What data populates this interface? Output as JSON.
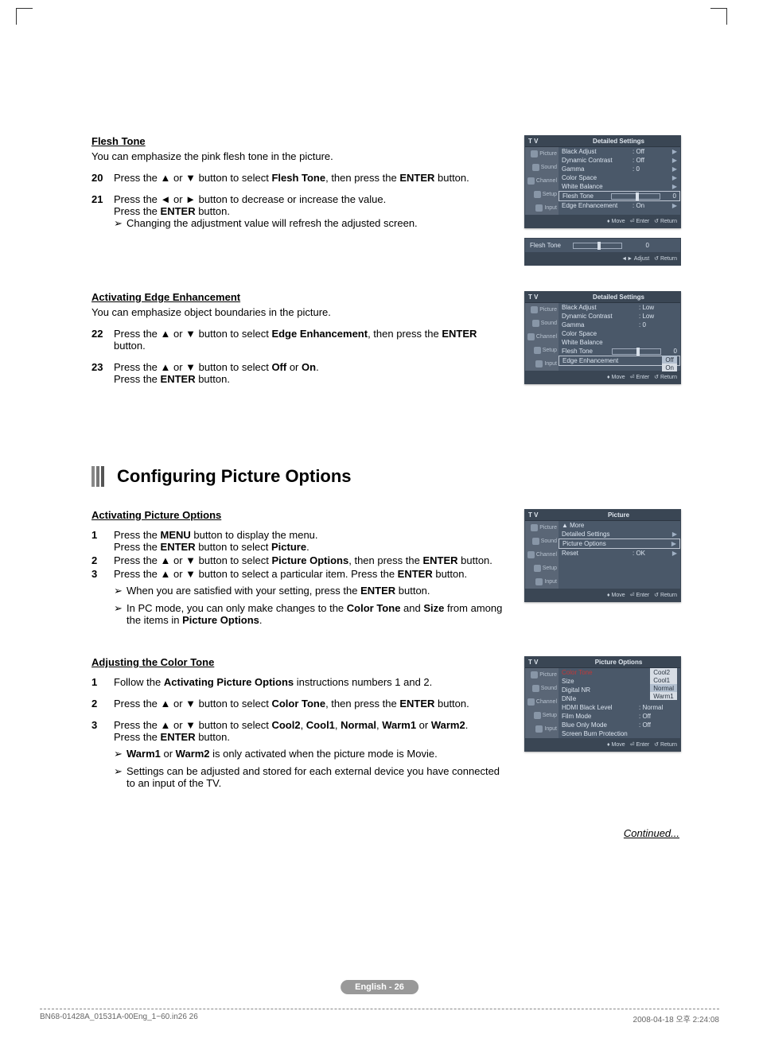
{
  "sections": {
    "flesh_tone": {
      "title": "Flesh Tone",
      "intro": "You can emphasize the pink flesh tone in the picture.",
      "step20_num": "20",
      "step20": "Press the ▲ or ▼ button to select <b>Flesh Tone</b>, then press the <b>ENTER</b> button.",
      "step21_num": "21",
      "step21a": "Press the ◄ or ► button to decrease or increase the value.",
      "step21b": "Press the <b>ENTER</b> button.",
      "step21_note": "Changing the adjustment value will refresh the adjusted screen."
    },
    "edge": {
      "title": "Activating Edge Enhancement",
      "intro": "You can emphasize object boundaries in the picture.",
      "step22_num": "22",
      "step22": "Press the ▲ or ▼ button to select <b>Edge Enhancement</b>, then press the <b>ENTER</b> button.",
      "step23_num": "23",
      "step23a": "Press the ▲ or ▼ button to select <b>Off</b> or <b>On</b>.",
      "step23b": "Press the <b>ENTER</b> button."
    },
    "conf_heading": "Configuring Picture Options",
    "activating": {
      "title": "Activating Picture Options",
      "s1_num": "1",
      "s1a": "Press the <b>MENU</b> button to display the menu.",
      "s1b": "Press the <b>ENTER</b> button to select <b>Picture</b>.",
      "s2_num": "2",
      "s2": "Press the ▲ or ▼ button to select <b>Picture Options</b>, then press the <b>ENTER</b> button.",
      "s3_num": "3",
      "s3": "Press the ▲ or ▼ button to select a particular item. Press the <b>ENTER</b> button.",
      "s3_note1": "When you are satisfied with your setting, press the <b>ENTER</b> button.",
      "s3_note2": "In PC mode, you can only make changes to the <b>Color Tone</b> and <b>Size</b> from among the items in <b>Picture Options</b>."
    },
    "color_tone": {
      "title": "Adjusting the Color Tone",
      "s1_num": "1",
      "s1": "Follow the <b>Activating Picture Options</b> instructions numbers 1 and 2.",
      "s2_num": "2",
      "s2": "Press the ▲ or ▼ button to select <b>Color Tone</b>, then press the <b>ENTER</b> button.",
      "s3_num": "3",
      "s3a": "Press the ▲ or ▼ button to select <b>Cool2</b>, <b>Cool1</b>, <b>Normal</b>, <b>Warm1</b> or <b>Warm2</b>.",
      "s3b": "Press the <b>ENTER</b> button.",
      "s3_note1": "<b>Warm1</b> or <b>Warm2</b> is only activated when the picture mode is Movie.",
      "s3_note2": "Settings can be adjusted and stored for each external device you have connected to an input of the TV."
    },
    "continued": "Continued...",
    "page_label": "English - 26",
    "footer_left": "BN68-01428A_01531A-00Eng_1~60.in26   26",
    "footer_right": "2008-04-18   오후 2:24:08"
  },
  "menus": {
    "side_labels": [
      "Picture",
      "Sound",
      "Channel",
      "Setup",
      "Input"
    ],
    "footer_move": "Move",
    "footer_enter": "Enter",
    "footer_return": "Return",
    "footer_adjust": "◄► Adjust",
    "tv_label": "T V",
    "detailed1": {
      "title": "Detailed Settings",
      "items": [
        {
          "label": "Black Adjust",
          "val": ": Off",
          "arrow": "▶"
        },
        {
          "label": "Dynamic Contrast",
          "val": ": Off",
          "arrow": "▶"
        },
        {
          "label": "Gamma",
          "val": ": 0",
          "arrow": "▶"
        },
        {
          "label": "Color Space",
          "val": "",
          "arrow": "▶"
        },
        {
          "label": "White Balance",
          "val": "",
          "arrow": "▶"
        },
        {
          "label": "Flesh Tone",
          "val": "",
          "slider": true,
          "sliderval": "0",
          "highlight": true
        },
        {
          "label": "Edge Enhancement",
          "val": ": On",
          "arrow": "▶"
        }
      ]
    },
    "flesh_slider": {
      "label": "Flesh Tone",
      "val": "0"
    },
    "detailed2": {
      "title": "Detailed Settings",
      "items": [
        {
          "label": "Black Adjust",
          "val": ": Low"
        },
        {
          "label": "Dynamic Contrast",
          "val": ": Low"
        },
        {
          "label": "Gamma",
          "val": ": 0"
        },
        {
          "label": "Color Space",
          "val": ""
        },
        {
          "label": "White Balance",
          "val": ""
        },
        {
          "label": "Flesh Tone",
          "val": "",
          "slider": true,
          "sliderval": "0"
        },
        {
          "label": "Edge Enhancement",
          "val": "",
          "highlight": true,
          "popup": [
            "Off",
            "On"
          ]
        }
      ]
    },
    "picture_menu": {
      "title": "Picture",
      "items": [
        {
          "label": "▲ More",
          "val": ""
        },
        {
          "label": "Detailed Settings",
          "val": "",
          "arrow": "▶"
        },
        {
          "label": "Picture Options",
          "val": "",
          "arrow": "▶",
          "highlight": true
        },
        {
          "label": "Reset",
          "val": ": OK",
          "arrow": "▶"
        }
      ]
    },
    "picture_options": {
      "title": "Picture Options",
      "items": [
        {
          "label": "Color Tone",
          "val": "",
          "red": true,
          "popup": [
            "Cool2",
            "Cool1",
            "Normal",
            "Warm1"
          ],
          "popup_sel": 2
        },
        {
          "label": "Size",
          "val": ""
        },
        {
          "label": "Digital NR",
          "val": ""
        },
        {
          "label": "DNIe",
          "val": ""
        },
        {
          "label": "HDMI Black Level",
          "val": ": Normal"
        },
        {
          "label": "Film Mode",
          "val": ": Off"
        },
        {
          "label": "Blue Only Mode",
          "val": ": Off"
        },
        {
          "label": "Screen Burn Protection",
          "val": ""
        }
      ]
    }
  }
}
